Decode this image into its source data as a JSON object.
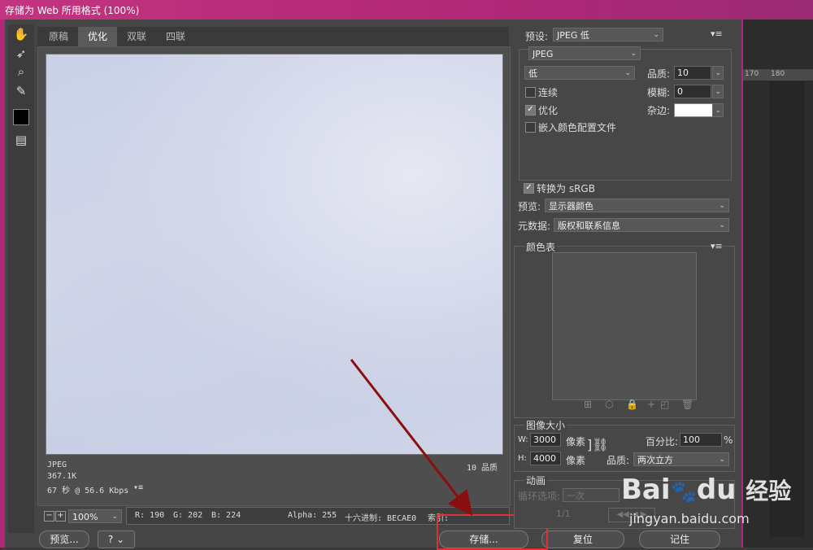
{
  "window": {
    "title": "存储为 Web 所用格式 (100%)"
  },
  "tabs": [
    {
      "label": "原稿"
    },
    {
      "label": "优化"
    },
    {
      "label": "双联"
    },
    {
      "label": "四联"
    }
  ],
  "tools": [
    "hand-icon",
    "slice-select-icon",
    "zoom-icon",
    "eyedropper-icon",
    "color-swatch-icon",
    "toggle-slices-icon"
  ],
  "preview_info": {
    "format": "JPEG",
    "size": "367.1K",
    "time": "67 秒 @ 56.6 Kbps",
    "quality": "10 品质"
  },
  "zoom": {
    "value": "100%",
    "minus": "−",
    "plus": "+"
  },
  "status": {
    "r": "R: 190",
    "g": "G: 202",
    "b": "B: 224",
    "alpha": "Alpha: 255",
    "hex": "十六进制: BECAE0",
    "index": "索引:"
  },
  "bottom_buttons": {
    "preview": "预览...",
    "save": "存储...",
    "reset": "复位",
    "remember": "记住",
    "help": "?"
  },
  "settings": {
    "preset_label": "预设:",
    "preset_value": "JPEG 低",
    "format_value": "JPEG",
    "quality_preset": "低",
    "quality_label": "品质:",
    "quality_value": "10",
    "blur_label": "模糊:",
    "blur_value": "0",
    "matte_label": "杂边:",
    "progressive_label": "连续",
    "optimized_label": "优化",
    "embed_profile_label": "嵌入颜色配置文件",
    "convert_srgb_label": "转换为 sRGB",
    "preview_label": "预览:",
    "preview_value": "显示器颜色",
    "metadata_label": "元数据:",
    "metadata_value": "版权和联系信息"
  },
  "color_table": {
    "title": "颜色表"
  },
  "image_size": {
    "title": "图像大小",
    "w_label": "W:",
    "w_value": "3000",
    "w_unit": "像素",
    "h_label": "H:",
    "h_value": "4000",
    "h_unit": "像素",
    "percent_label": "百分比:",
    "percent_value": "100",
    "percent_unit": "%",
    "quality_label": "品质:",
    "quality_value": "两次立方"
  },
  "animation": {
    "title": "动画",
    "loop_label": "循环选项:",
    "loop_value": "一次",
    "frame": "1/1"
  },
  "ruler": {
    "t1": "170",
    "t2": "180"
  },
  "watermark": {
    "brand": "Bai",
    "brand2": "du",
    "jingyan": "经验",
    "url": "jingyan.baidu.com"
  }
}
